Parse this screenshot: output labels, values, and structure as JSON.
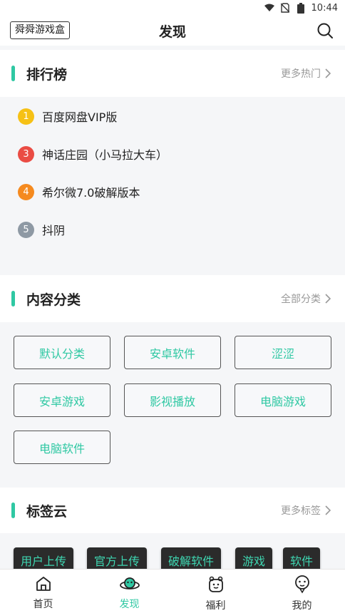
{
  "status": {
    "time": "10:44"
  },
  "header": {
    "brand": "舜舜游戏盒",
    "title": "发现"
  },
  "ranking": {
    "title": "排行榜",
    "more": "更多热门",
    "items": [
      {
        "num": "1",
        "label": "百度网盘VIP版",
        "color": "#f6c115"
      },
      {
        "num": "3",
        "label": "神话庄园（小马拉大车）",
        "color": "#ea4c44"
      },
      {
        "num": "4",
        "label": "希尔微7.0破解版本",
        "color": "#f58a1f"
      },
      {
        "num": "5",
        "label": "抖阴",
        "color": "#8e99a4"
      }
    ]
  },
  "categories": {
    "title": "内容分类",
    "more": "全部分类",
    "items": [
      "默认分类",
      "安卓软件",
      "涩涩",
      "安卓游戏",
      "影视播放",
      "电脑游戏",
      "电脑软件"
    ]
  },
  "tags": {
    "title": "标签云",
    "more": "更多标签",
    "items": [
      "用户上传",
      "官方上传",
      "破解软件",
      "游戏",
      "软件"
    ]
  },
  "tabbar": {
    "items": [
      {
        "label": "首页",
        "icon": "home-icon"
      },
      {
        "label": "发现",
        "icon": "planet-icon"
      },
      {
        "label": "福利",
        "icon": "gift-bear-icon"
      },
      {
        "label": "我的",
        "icon": "profile-icon"
      }
    ],
    "active_color": "#2fc8a3"
  }
}
